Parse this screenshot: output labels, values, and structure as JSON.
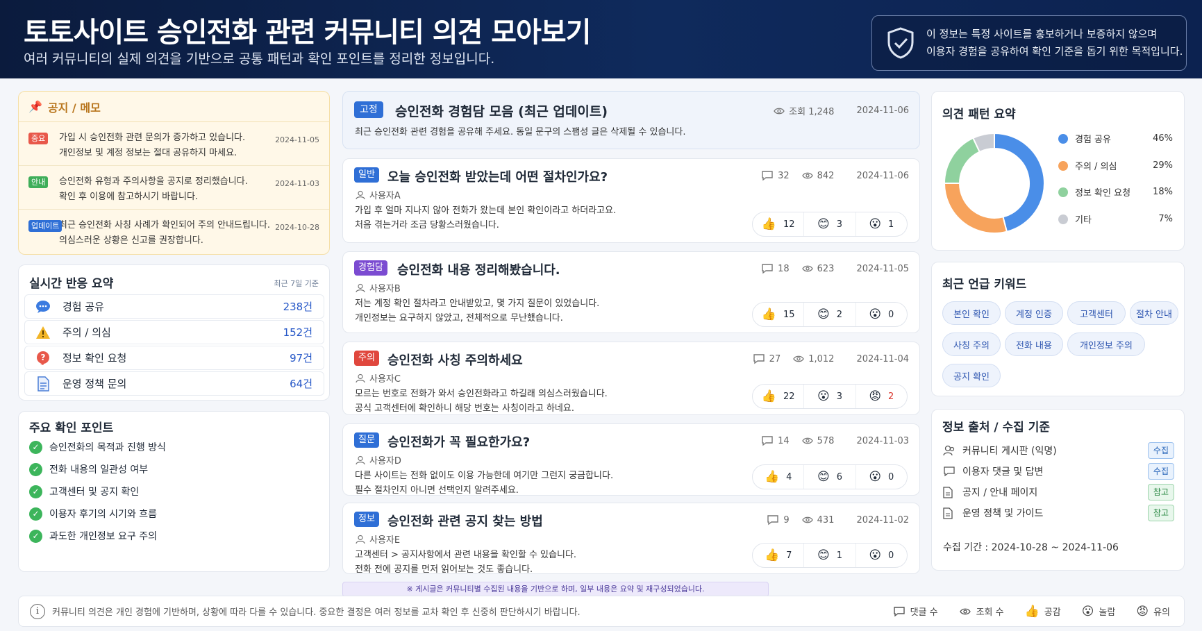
{
  "header": {
    "title": "토토사이트 승인전화 관련 커뮤니티 의견 모아보기",
    "subtitle": "여러 커뮤니티의 실제 의견을 기반으로 공통 패턴과 확인 포인트를 정리한 정보입니다.",
    "disclaimer_line1": "이 정보는 특정 사이트를 홍보하거나 보증하지 않으며",
    "disclaimer_line2": "이용자 경험을 공유하여 확인 기준을 돕기 위한 목적입니다."
  },
  "notice": {
    "title": "공지 / 메모",
    "items": [
      {
        "badge": "중요",
        "color": "#e8584a",
        "line1": "가입 시 승인전화 관련 문의가 증가하고 있습니다.",
        "line2": "개인정보 및 계정 정보는 절대 공유하지 마세요.",
        "date": "2024-11-05"
      },
      {
        "badge": "안내",
        "color": "#3fae5a",
        "line1": "승인전화 유형과 주의사항을 공지로 정리했습니다.",
        "line2": "확인 후 이용에 참고하시기 바랍니다.",
        "date": "2024-11-03"
      },
      {
        "badge": "업데이트",
        "color": "#2f6fd6",
        "line1": "최근 승인전화 사칭 사례가 확인되어 주의 안내드립니다.",
        "line2": "의심스러운 상황은 신고를 권장합니다.",
        "date": "2024-10-28"
      }
    ]
  },
  "summary": {
    "title": "실시간 반응 요약",
    "basis": "최근 7일 기준",
    "rows": [
      {
        "label": "경험 공유",
        "count": "238건",
        "icon": "chat-bubble-icon"
      },
      {
        "label": "주의 / 의심",
        "count": "152건",
        "icon": "warning-icon"
      },
      {
        "label": "정보 확인 요청",
        "count": "97건",
        "icon": "question-icon"
      },
      {
        "label": "운영 정책 문의",
        "count": "64건",
        "icon": "document-icon"
      }
    ]
  },
  "checks": {
    "title": "주요 확인 포인트",
    "items": [
      "승인전화의 목적과 진행 방식",
      "전화 내용의 일관성 여부",
      "고객센터 및 공지 확인",
      "이용자 후기의 시기와 흐름",
      "과도한 개인정보 요구 주의"
    ]
  },
  "pinned": {
    "badge": "고정",
    "title": "승인전화 경험담 모음 (최근 업데이트)",
    "views": "조회 1,248",
    "date": "2024-11-06",
    "body": "최근 승인전화 관련 경험을 공유해 주세요. 동일 문구의 스팸성 글은 삭제될 수 있습니다."
  },
  "posts": [
    {
      "badge": "일반",
      "color": "#2f6fd6",
      "title": "오늘 승인전화 받았는데 어떤 절차인가요?",
      "comments": "32",
      "views": "842",
      "date": "2024-11-06",
      "author": "사용자A",
      "line1": "가입 후 얼마 지나지 않아 전화가 왔는데 본인 확인이라고 하더라고요.",
      "line2": "처음 겪는거라 조금 당황스러웠습니다.",
      "r1": "12",
      "r2": "3",
      "r3": "1",
      "e2": "😊",
      "e3": "😮"
    },
    {
      "badge": "경험담",
      "color": "#7b4bd1",
      "title": "승인전화 내용 정리해봤습니다.",
      "comments": "18",
      "views": "623",
      "date": "2024-11-05",
      "author": "사용자B",
      "line1": "저는 계정 확인 절차라고 안내받았고, 몇 가지 질문이 있었습니다.",
      "line2": "개인정보는 요구하지 않았고, 전체적으로 무난했습니다.",
      "r1": "15",
      "r2": "2",
      "r3": "0",
      "e2": "😊",
      "e3": "😮"
    },
    {
      "badge": "주의",
      "color": "#e0473d",
      "title": "승인전화 사칭 주의하세요",
      "comments": "27",
      "views": "1,012",
      "date": "2024-11-04",
      "author": "사용자C",
      "line1": "모르는 번호로 전화가 와서 승인전화라고 하길래 의심스러웠습니다.",
      "line2": "공식 고객센터에 확인하니 해당 번호는 사칭이라고 하네요.",
      "r1": "22",
      "r2": "3",
      "r3": "2",
      "e2": "😮",
      "e3": "😡"
    },
    {
      "badge": "질문",
      "color": "#2f6fd6",
      "title": "승인전화가 꼭 필요한가요?",
      "comments": "14",
      "views": "578",
      "date": "2024-11-03",
      "author": "사용자D",
      "line1": "다른 사이트는 전화 없이도 이용 가능한데 여기만 그런지 궁금합니다.",
      "line2": "필수 절차인지 아니면 선택인지 알려주세요.",
      "r1": "4",
      "r2": "6",
      "r3": "0",
      "e2": "😊",
      "e3": "😮"
    },
    {
      "badge": "정보",
      "color": "#2f6fd6",
      "title": "승인전화 관련 공지 찾는 방법",
      "comments": "9",
      "views": "431",
      "date": "2024-11-02",
      "author": "사용자E",
      "line1": "고객센터 > 공지사항에서 관련 내용을 확인할 수 있습니다.",
      "line2": "전화 전에 공지를 먼저 읽어보는 것도 좋습니다.",
      "r1": "7",
      "r2": "1",
      "r3": "0",
      "e2": "😊",
      "e3": "😮"
    }
  ],
  "source_note": "※ 게시글은 커뮤니티별 수집된 내용을 기반으로 하며, 일부 내용은 요약 및 재구성되었습니다.",
  "pattern": {
    "title": "의견 패턴 요약",
    "chart_data": {
      "type": "pie",
      "categories": [
        "경험 공유",
        "주의 / 의심",
        "정보 확인 요청",
        "기타"
      ],
      "values": [
        46,
        29,
        18,
        7
      ],
      "value_labels": [
        "46%",
        "29%",
        "18%",
        "7%"
      ],
      "colors": [
        "#4a8ee8",
        "#f7a35c",
        "#8fd19e",
        "#c9ccd3"
      ]
    }
  },
  "keywords": {
    "title": "최근 언급 키워드",
    "items": [
      "본인 확인",
      "계정 인증",
      "고객센터",
      "절차 안내",
      "사칭 주의",
      "전화 내용",
      "개인정보 주의",
      "공지 확인"
    ]
  },
  "sources": {
    "title": "정보 출처 / 수집 기준",
    "rows": [
      {
        "name": "커뮤니티 게시판 (익명)",
        "tag": "수집",
        "kind": "collect"
      },
      {
        "name": "이용자 댓글 및 답변",
        "tag": "수집",
        "kind": "collect"
      },
      {
        "name": "공지 / 안내 페이지",
        "tag": "참고",
        "kind": "ref"
      },
      {
        "name": "운영 정책 및 가이드",
        "tag": "참고",
        "kind": "ref"
      }
    ],
    "period": "수집 기간 : 2024-10-28 ~ 2024-11-06"
  },
  "footer": {
    "text": "커뮤니티 의견은 개인 경험에 기반하며, 상황에 따라 다를 수 있습니다. 중요한 결정은 여러 정보를 교차 확인 후 신중히 판단하시기 바랍니다.",
    "legend": {
      "comments": "댓글 수",
      "views": "조회 수",
      "like": "공감",
      "surprise": "놀람",
      "caution": "유의"
    }
  }
}
